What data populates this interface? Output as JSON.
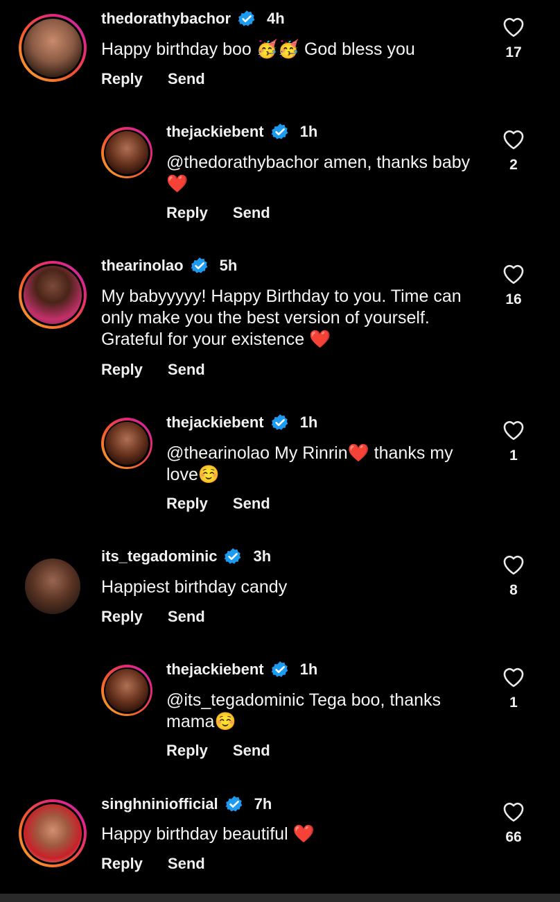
{
  "reply_label": "Reply",
  "send_label": "Send",
  "comments": [
    {
      "user": "thedorathybachor",
      "time": "4h",
      "text": "Happy birthday boo 🥳🥳 God bless you",
      "likes": "17"
    },
    {
      "user": "thejackiebent",
      "time": "1h",
      "text": "@thedorathybachor amen, thanks baby❤️",
      "likes": "2"
    },
    {
      "user": "thearinolao",
      "time": "5h",
      "text": "My babyyyyy! Happy Birthday to you. Time can only make you the best version of yourself. Grateful for your existence ❤️",
      "likes": "16"
    },
    {
      "user": "thejackiebent",
      "time": "1h",
      "text": "@thearinolao My Rinrin❤️ thanks my love☺️",
      "likes": "1"
    },
    {
      "user": "its_tegadominic",
      "time": "3h",
      "text": "Happiest birthday candy",
      "likes": "8"
    },
    {
      "user": "thejackiebent",
      "time": "1h",
      "text": "@its_tegadominic Tega boo, thanks mama☺️",
      "likes": "1"
    },
    {
      "user": "singhniniofficial",
      "time": "7h",
      "text": "Happy birthday beautiful ❤️",
      "likes": "66"
    }
  ],
  "colors": {
    "background": "#000000",
    "verified": "#1d9bf0",
    "ring_start": "#f9b02c",
    "ring_end": "#c02fc7"
  }
}
